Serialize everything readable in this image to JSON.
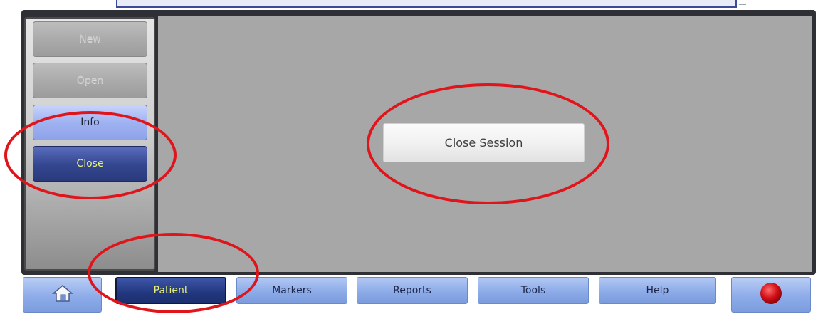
{
  "sidebar": {
    "items": [
      {
        "label": "New",
        "state": "disabled"
      },
      {
        "label": "Open",
        "state": "disabled"
      },
      {
        "label": "Info",
        "state": "normal"
      },
      {
        "label": "Close",
        "state": "selected"
      }
    ]
  },
  "main": {
    "close_session_label": "Close Session"
  },
  "bottom_tabs": [
    {
      "label": "Patient",
      "active": true
    },
    {
      "label": "Markers",
      "active": false
    },
    {
      "label": "Reports",
      "active": false
    },
    {
      "label": "Tools",
      "active": false
    },
    {
      "label": "Help",
      "active": false
    }
  ],
  "icons": {
    "home": "home-icon",
    "record": "record-icon"
  },
  "colors": {
    "highlight_ring": "#e0151b",
    "active_tab": "#22377f",
    "active_text": "#e7f07a",
    "content_bg": "#a8a7a8"
  }
}
